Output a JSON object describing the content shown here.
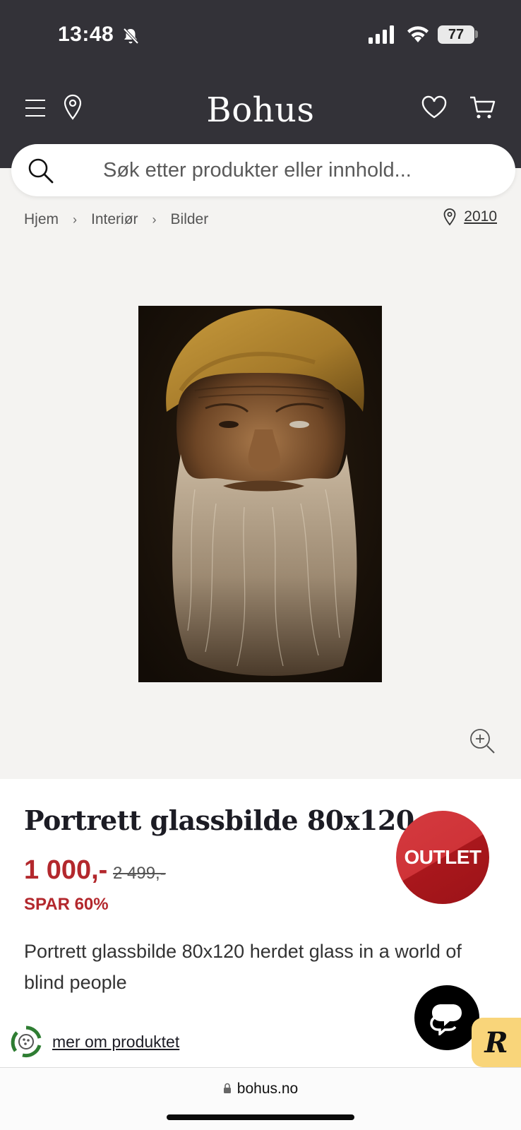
{
  "status_bar": {
    "time": "13:48",
    "battery": "77"
  },
  "header": {
    "logo": "Bohus"
  },
  "search": {
    "placeholder": "Søk etter produkter eller innhold..."
  },
  "breadcrumb": {
    "items": [
      "Hjem",
      "Interiør",
      "Bilder"
    ],
    "postal_code": "2010"
  },
  "product": {
    "title": "Portrett glassbilde 80x120",
    "price": "1 000,-",
    "old_price": "2 499,-",
    "savings": "SPAR 60%",
    "badge": "OUTLET",
    "description": "Portrett glassbilde 80x120 herdet glass in a world of blind people",
    "more_link": "mer om produktet"
  },
  "browser": {
    "url": "bohus.no"
  },
  "colors": {
    "header_bg": "#333238",
    "accent_red": "#b3282d",
    "page_bg": "#f4f3f1"
  }
}
